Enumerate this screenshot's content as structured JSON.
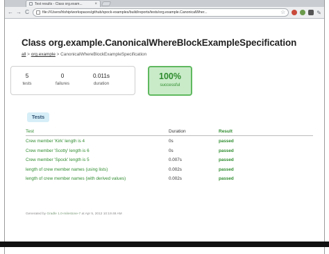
{
  "browser": {
    "tab_title": "Test results - Class org.exam...",
    "tab_close": "×",
    "url": "file:///Users/hlship/workspaces/github/spock-examples/build/reports/tests/org.example.CanonicalWher...",
    "back": "←",
    "forward": "→",
    "reload": "C",
    "star": "☆",
    "wrench": "✎"
  },
  "page": {
    "title": "Class org.example.CanonicalWhereBlockExampleSpecification",
    "breadcrumb": {
      "all": "all",
      "sep1": " > ",
      "package": "org.example",
      "sep2": " > ",
      "current": "CanonicalWhereBlockExampleSpecification"
    },
    "summary": {
      "tests_value": "5",
      "tests_label": "tests",
      "failures_value": "0",
      "failures_label": "failures",
      "duration_value": "0.011s",
      "duration_label": "duration"
    },
    "success": {
      "percent": "100%",
      "label": "successful"
    },
    "tab_tests": "Tests",
    "table": {
      "headers": [
        "Test",
        "Duration",
        "Result"
      ],
      "rows": [
        {
          "test": "Crew member 'Kirk' length is 4",
          "duration": "0s",
          "result": "passed"
        },
        {
          "test": "Crew member 'Scotty' length is 6",
          "duration": "0s",
          "result": "passed"
        },
        {
          "test": "Crew member 'Spock' length is 5",
          "duration": "0.007s",
          "result": "passed"
        },
        {
          "test": "length of crew member names (using lists)",
          "duration": "0.002s",
          "result": "passed"
        },
        {
          "test": "length of crew member names (with derived values)",
          "duration": "0.002s",
          "result": "passed"
        }
      ]
    },
    "footer": {
      "prefix": "Generated by ",
      "link": "Gradle 1.0-milestone-7",
      "suffix": " at Apr 5, 2012 10:19:48 AM"
    }
  }
}
